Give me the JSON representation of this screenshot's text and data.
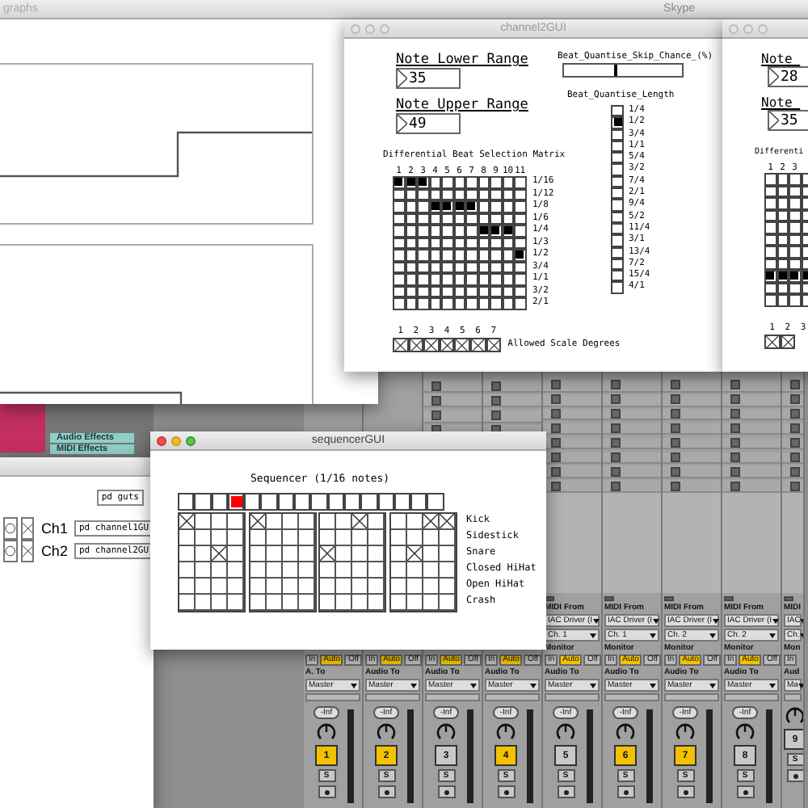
{
  "graphs_window": {
    "title": "graphs"
  },
  "skype_bar": {
    "title": "Skype"
  },
  "channel2_window": {
    "title": "channel2GUI",
    "lower": {
      "label": "Note_Lower_Range",
      "value": "35"
    },
    "upper": {
      "label": "Note_Upper_Range",
      "value": "49"
    },
    "skip_chance": {
      "label": "Beat_Quantise_Skip_Chance_(%)",
      "level": 0.43
    },
    "length": {
      "label": "Beat_Quantise_Length",
      "options": [
        {
          "label": "1/4",
          "selected": false
        },
        {
          "label": "1/2",
          "selected": true
        },
        {
          "label": "3/4",
          "selected": false
        },
        {
          "label": "1/1",
          "selected": false
        },
        {
          "label": "5/4",
          "selected": false
        },
        {
          "label": "3/2",
          "selected": false
        },
        {
          "label": "7/4",
          "selected": false
        },
        {
          "label": "2/1",
          "selected": false
        },
        {
          "label": "9/4",
          "selected": false
        },
        {
          "label": "5/2",
          "selected": false
        },
        {
          "label": "11/4",
          "selected": false
        },
        {
          "label": "3/1",
          "selected": false
        },
        {
          "label": "13/4",
          "selected": false
        },
        {
          "label": "7/2",
          "selected": false
        },
        {
          "label": "15/4",
          "selected": false
        },
        {
          "label": "4/1",
          "selected": false
        }
      ]
    },
    "matrix": {
      "title": "Differential Beat Selection Matrix",
      "columns": [
        "1",
        "2",
        "3",
        "4",
        "5",
        "6",
        "7",
        "8",
        "9",
        "10",
        "11"
      ],
      "rows": [
        {
          "label": "1/16",
          "cells": [
            true,
            true,
            true,
            false,
            false,
            false,
            false,
            false,
            false,
            false,
            false
          ]
        },
        {
          "label": "1/12",
          "cells": [
            false,
            false,
            false,
            false,
            false,
            false,
            false,
            false,
            false,
            false,
            false
          ]
        },
        {
          "label": "1/8",
          "cells": [
            false,
            false,
            false,
            true,
            true,
            true,
            true,
            false,
            false,
            false,
            false
          ]
        },
        {
          "label": "1/6",
          "cells": [
            false,
            false,
            false,
            false,
            false,
            false,
            false,
            false,
            false,
            false,
            false
          ]
        },
        {
          "label": "1/4",
          "cells": [
            false,
            false,
            false,
            false,
            false,
            false,
            false,
            true,
            true,
            true,
            false
          ]
        },
        {
          "label": "1/3",
          "cells": [
            false,
            false,
            false,
            false,
            false,
            false,
            false,
            false,
            false,
            false,
            false
          ]
        },
        {
          "label": "1/2",
          "cells": [
            false,
            false,
            false,
            false,
            false,
            false,
            false,
            false,
            false,
            false,
            true
          ]
        },
        {
          "label": "3/4",
          "cells": [
            false,
            false,
            false,
            false,
            false,
            false,
            false,
            false,
            false,
            false,
            false
          ]
        },
        {
          "label": "1/1",
          "cells": [
            false,
            false,
            false,
            false,
            false,
            false,
            false,
            false,
            false,
            false,
            false
          ]
        },
        {
          "label": "3/2",
          "cells": [
            false,
            false,
            false,
            false,
            false,
            false,
            false,
            false,
            false,
            false,
            false
          ]
        },
        {
          "label": "2/1",
          "cells": [
            false,
            false,
            false,
            false,
            false,
            false,
            false,
            false,
            false,
            false,
            false
          ]
        }
      ]
    },
    "scale_degrees": {
      "numbers": [
        "1",
        "2",
        "3",
        "4",
        "5",
        "6",
        "7"
      ],
      "toggles": [
        {
          "checked": true
        },
        {
          "checked": true
        },
        {
          "checked": true
        },
        {
          "checked": true
        },
        {
          "checked": true
        },
        {
          "checked": true
        },
        {
          "checked": true
        }
      ],
      "label": "Allowed Scale Degrees"
    }
  },
  "channel3_window": {
    "lower": {
      "label": "Note_",
      "value": "28"
    },
    "upper": {
      "label": "Note_",
      "value": "35"
    },
    "matrix": {
      "title": "Differenti",
      "columns": [
        "1",
        "2",
        "3"
      ],
      "rows": [
        {
          "cells": [
            false,
            false,
            false,
            false
          ]
        },
        {
          "cells": [
            false,
            false,
            false,
            false
          ]
        },
        {
          "cells": [
            false,
            false,
            false,
            false
          ]
        },
        {
          "cells": [
            false,
            false,
            false,
            false
          ]
        },
        {
          "cells": [
            false,
            false,
            false,
            false
          ]
        },
        {
          "cells": [
            false,
            false,
            false,
            false
          ]
        },
        {
          "cells": [
            false,
            false,
            false,
            false
          ]
        },
        {
          "cells": [
            false,
            false,
            false,
            false
          ]
        },
        {
          "cells": [
            true,
            true,
            true,
            true
          ]
        },
        {
          "cells": [
            false,
            false,
            false,
            false
          ]
        },
        {
          "cells": [
            false,
            false,
            false,
            false
          ]
        }
      ]
    },
    "scale_degrees": {
      "numbers": [
        "1",
        "2",
        "3"
      ],
      "toggles": [
        {
          "checked": true
        },
        {
          "checked": true
        }
      ]
    }
  },
  "browser": {
    "items": [
      {
        "label": "Audio Effects"
      },
      {
        "label": "MIDI Effects"
      }
    ]
  },
  "patch_window": {
    "objects": [
      {
        "text": "pd guts"
      }
    ],
    "channels": [
      {
        "label": "Ch1",
        "object": "pd channel1GU",
        "toggle": true
      },
      {
        "label": "Ch2",
        "object": "pd channel2GU",
        "toggle": true
      }
    ]
  },
  "sequencer_window": {
    "title": "sequencerGUI",
    "heading": "Sequencer (1/16 notes)",
    "position_cells": [
      {
        "lit": false
      },
      {
        "lit": false
      },
      {
        "lit": false
      },
      {
        "lit": true
      },
      {
        "lit": false
      },
      {
        "lit": false
      },
      {
        "lit": false
      },
      {
        "lit": false
      },
      {
        "lit": false
      },
      {
        "lit": false
      },
      {
        "lit": false
      },
      {
        "lit": false
      },
      {
        "lit": false
      },
      {
        "lit": false
      },
      {
        "lit": false
      },
      {
        "lit": false
      }
    ],
    "instruments": [
      {
        "label": "Kick",
        "steps": [
          true,
          false,
          false,
          false,
          true,
          false,
          false,
          false,
          false,
          false,
          true,
          false,
          false,
          false,
          true,
          true
        ]
      },
      {
        "label": "Sidestick",
        "steps": [
          false,
          false,
          false,
          false,
          false,
          false,
          false,
          false,
          false,
          false,
          false,
          false,
          false,
          false,
          false,
          false
        ]
      },
      {
        "label": "Snare",
        "steps": [
          false,
          false,
          true,
          false,
          false,
          false,
          false,
          false,
          true,
          false,
          false,
          false,
          false,
          true,
          false,
          false
        ]
      },
      {
        "label": "Closed HiHat",
        "steps": [
          false,
          false,
          false,
          false,
          false,
          false,
          false,
          false,
          false,
          false,
          false,
          false,
          false,
          false,
          false,
          false
        ]
      },
      {
        "label": "Open HiHat",
        "steps": [
          false,
          false,
          false,
          false,
          false,
          false,
          false,
          false,
          false,
          false,
          false,
          false,
          false,
          false,
          false,
          false
        ]
      },
      {
        "label": "Crash",
        "steps": [
          false,
          false,
          false,
          false,
          false,
          false,
          false,
          false,
          false,
          false,
          false,
          false,
          false,
          false,
          false,
          false
        ]
      }
    ]
  },
  "mixer": {
    "tracks": [
      {
        "kind": "lower",
        "monitor": [
          {
            "label": "In",
            "selected": false
          },
          {
            "label": "Auto",
            "selected": true
          },
          {
            "label": "Off",
            "selected": false
          }
        ],
        "audio_to": "A. To",
        "output": "Master",
        "volume": "-Inf",
        "number": "1",
        "selected": true,
        "solo": "S"
      },
      {
        "kind": "lower",
        "monitor": [
          {
            "label": "In",
            "selected": false
          },
          {
            "label": "Auto",
            "selected": true
          },
          {
            "label": "Off",
            "selected": false
          }
        ],
        "audio_to": "Audio To",
        "output": "Master",
        "volume": "-Inf",
        "number": "2",
        "selected": true,
        "solo": "S"
      },
      {
        "kind": "covered",
        "monitor": [
          {
            "label": "In",
            "selected": false
          },
          {
            "label": "Auto",
            "selected": true
          },
          {
            "label": "Off",
            "selected": false
          }
        ],
        "audio_to": "Audio To",
        "output": "Master",
        "volume": "-Inf",
        "number": "3",
        "selected": false,
        "solo": "S"
      },
      {
        "kind": "covered",
        "monitor": [
          {
            "label": "In",
            "selected": false
          },
          {
            "label": "Auto",
            "selected": true
          },
          {
            "label": "Off",
            "selected": false
          }
        ],
        "audio_to": "Audio To",
        "output": "Master",
        "volume": "-Inf",
        "number": "4",
        "selected": true,
        "solo": "S"
      },
      {
        "kind": "full",
        "midi_from": "MIDI From",
        "device": "IAC Driver (I",
        "channel": "Ch. 1",
        "monitor_label": "Monitor",
        "monitor": [
          {
            "label": "In",
            "selected": false
          },
          {
            "label": "Auto",
            "selected": true
          },
          {
            "label": "Off",
            "selected": false
          }
        ],
        "audio_to": "Audio To",
        "output": "Master",
        "volume": "-Inf",
        "number": "5",
        "selected": false,
        "solo": "S"
      },
      {
        "kind": "full",
        "midi_from": "MIDI From",
        "device": "IAC Driver (I",
        "channel": "Ch. 1",
        "monitor_label": "Monitor",
        "monitor": [
          {
            "label": "In",
            "selected": false
          },
          {
            "label": "Auto",
            "selected": true
          },
          {
            "label": "Off",
            "selected": false
          }
        ],
        "audio_to": "Audio To",
        "output": "Master",
        "volume": "-Inf",
        "number": "6",
        "selected": true,
        "solo": "S"
      },
      {
        "kind": "full",
        "midi_from": "MIDI From",
        "device": "IAC Driver (I",
        "channel": "Ch. 2",
        "monitor_label": "Monitor",
        "monitor": [
          {
            "label": "In",
            "selected": false
          },
          {
            "label": "Auto",
            "selected": true
          },
          {
            "label": "Off",
            "selected": false
          }
        ],
        "audio_to": "Audio To",
        "output": "Master",
        "volume": "-Inf",
        "number": "7",
        "selected": true,
        "solo": "S"
      },
      {
        "kind": "full",
        "midi_from": "MIDI From",
        "device": "IAC Driver (I",
        "channel": "Ch. 2",
        "monitor_label": "Monitor",
        "monitor": [
          {
            "label": "In",
            "selected": false
          },
          {
            "label": "Auto",
            "selected": true
          },
          {
            "label": "Off",
            "selected": false
          }
        ],
        "audio_to": "Audio To",
        "output": "Master",
        "volume": "-Inf",
        "number": "8",
        "selected": false,
        "solo": "S"
      },
      {
        "kind": "edge",
        "midi_from": "MIDI",
        "device": "IAC",
        "channel": "Ch.",
        "monitor_label": "Mon",
        "monitor": [
          {
            "label": "In",
            "selected": false
          }
        ],
        "audio_to": "Aud",
        "output": "Ma",
        "number": "9",
        "selected": false,
        "solo": "S"
      }
    ]
  }
}
